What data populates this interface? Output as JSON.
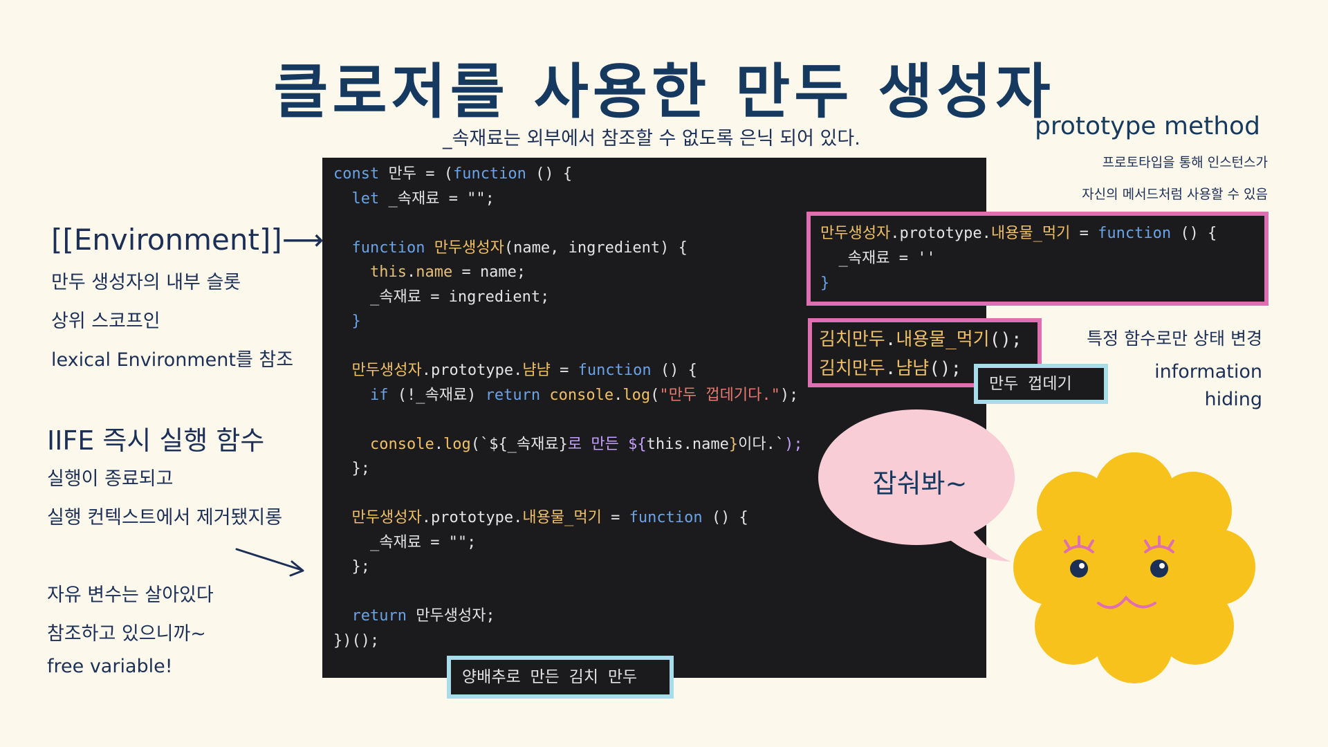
{
  "title": "클로저를 사용한 만두 생성자",
  "subtitle": "_속재료는 외부에서 참조할 수 없도록 은닉 되어 있다.",
  "left_notes": {
    "environment_heading": "[[Environment]]",
    "environment_arrow": "⟶",
    "environment_lines": [
      "만두 생성자의 내부 슬롯",
      "상위 스코프인",
      "lexical Environment를 참조"
    ],
    "iife_heading": "IIFE 즉시 실행 함수",
    "iife_lines": [
      "실행이 종료되고",
      "실행 컨텍스트에서 제거됐지롱"
    ],
    "free_var_lines": [
      "자유 변수는 살아있다",
      "참조하고 있으니까~",
      "free variable!"
    ]
  },
  "right_notes": {
    "proto_heading": "prototype method",
    "proto_desc": [
      "프로토타입을 통해 인스턴스가",
      "자신의 메서드처럼 사용할 수 있음"
    ],
    "state_change": "특정 함수로만 상태 변경",
    "info_hiding": [
      "information",
      "hiding"
    ]
  },
  "code": {
    "l1": [
      "const",
      " 만두 = (",
      "function",
      " () {"
    ],
    "l2": [
      "  let",
      " _속재료 = \"\";"
    ],
    "l4": [
      "  function",
      " ",
      "만두생성자",
      "(name, ingredient) {"
    ],
    "l5": [
      "    ",
      "this",
      ".",
      "name",
      " = name;"
    ],
    "l6": "    _속재료 = ingredient;",
    "l7": "  }",
    "l9": [
      "  ",
      "만두생성자",
      ".prototype.",
      "냠냠",
      " = ",
      "function",
      " () {"
    ],
    "l10": [
      "    ",
      "if",
      " (!_속재료) ",
      "return",
      " ",
      "console",
      ".",
      "log",
      "(",
      "\"만두 껍데기다.\"",
      ");"
    ],
    "l12": [
      "    ",
      "console",
      ".",
      "log",
      "(`${_속재료}",
      "로 만든 ",
      "${",
      "this.name",
      "}",
      "이다.`",
      ");"
    ],
    "l13": "  };",
    "l15": [
      "  ",
      "만두생성자",
      ".prototype.",
      "내용물_먹기",
      " = ",
      "function",
      " () {"
    ],
    "l16": "    _속재료 = \"\";",
    "l17": "  };",
    "l19": [
      "  ",
      "return",
      " 만두생성자;"
    ],
    "l20": "})();"
  },
  "proto_box": {
    "l1": [
      "만두생성자",
      ".prototype.",
      "내용물_먹기",
      " = ",
      "function",
      " () {"
    ],
    "l2": "  _속재료 = ''",
    "l3": "}"
  },
  "call_box": {
    "l1": [
      "김치만두",
      ".",
      "내용물_먹기",
      "();"
    ],
    "l2": [
      "김치만두",
      ".",
      "냠냠",
      "();"
    ]
  },
  "empty_shell_output": "만두 껍데기",
  "kimchi_output": "양배추로 만든 김치 만두",
  "bubble_text": "잡숴봐~",
  "colors": {
    "background": "#fdf8ec",
    "code_bg": "#1b1b1d",
    "pink_border": "#de6fb0",
    "blue_border": "#a8dcea",
    "flower": "#f8c21d",
    "bubble": "#f8cdd6",
    "heading": "#163a5f"
  },
  "icons": [
    "arrow-right-icon",
    "arrow-down-right-icon",
    "flower-character-icon",
    "speech-bubble-icon"
  ]
}
